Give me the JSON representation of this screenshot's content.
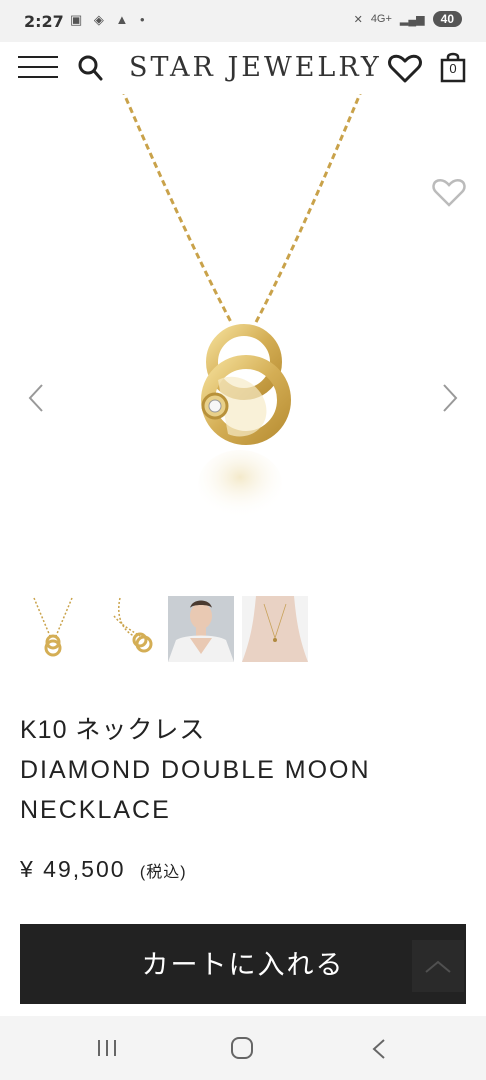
{
  "status_bar": {
    "time": "2:27",
    "signal_label": "4G+",
    "battery": "40"
  },
  "header": {
    "brand": "STAR JEWELRY",
    "cart_count": "0"
  },
  "product": {
    "title_ja": "K10 ネックレス",
    "title_en": "DIAMOND DOUBLE MOON NECKLACE",
    "price": "¥ 49,500",
    "price_tax": "(税込)",
    "cart_button": "カートに入れる",
    "thumbnail_count": 4
  },
  "colors": {
    "button_bg": "#222222",
    "gold": "#d9b45a",
    "status_bg": "#f2f2f2",
    "navbar_bg": "#f4f4f4"
  },
  "icons": [
    "menu-icon",
    "search-icon",
    "heart-icon",
    "bag-icon",
    "favorite-icon",
    "chevron-left-icon",
    "chevron-right-icon",
    "scroll-top-icon",
    "recents-icon",
    "home-icon",
    "back-icon"
  ]
}
